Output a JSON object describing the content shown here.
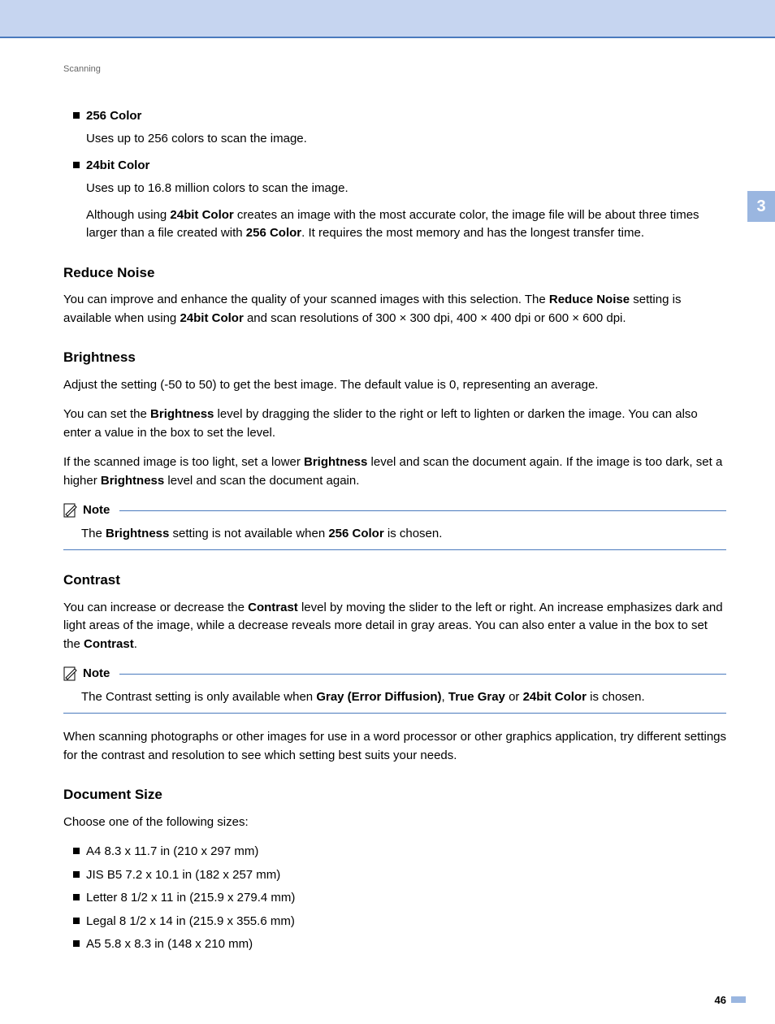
{
  "breadcrumb": "Scanning",
  "chapterTab": "3",
  "pageNumber": "46",
  "color256": {
    "title": "256 Color",
    "desc": "Uses up to 256 colors to scan the image."
  },
  "color24": {
    "title": "24bit Color",
    "desc1": "Uses up to 16.8 million colors to scan the image.",
    "desc2a": "Although using ",
    "desc2b": "24bit Color",
    "desc2c": " creates an image with the most accurate color, the image file will be about three times larger than a file created with ",
    "desc2d": "256 Color",
    "desc2e": ". It requires the most memory and has the longest transfer time."
  },
  "reduceNoise": {
    "heading": "Reduce Noise",
    "p1a": "You can improve and enhance the quality of your scanned images with this selection. The ",
    "p1b": "Reduce Noise",
    "p1c": " setting is available when using ",
    "p1d": "24bit Color",
    "p1e": " and scan resolutions of 300 × 300 dpi, 400 × 400 dpi or 600 × 600 dpi."
  },
  "brightness": {
    "heading": "Brightness",
    "p1": "Adjust the setting (-50 to 50) to get the best image. The default value is 0, representing an average.",
    "p2a": "You can set the ",
    "p2b": "Brightness",
    "p2c": " level by dragging the slider to the right or left to lighten or darken the image. You can also enter a value in the box to set the level.",
    "p3a": "If the scanned image is too light, set a lower ",
    "p3b": "Brightness",
    "p3c": " level and scan the document again. If the image is too dark, set a higher ",
    "p3d": "Brightness",
    "p3e": " level and scan the document again.",
    "noteLabel": "Note",
    "note1a": "The ",
    "note1b": "Brightness",
    "note1c": " setting is not available when ",
    "note1d": "256 Color",
    "note1e": " is chosen."
  },
  "contrast": {
    "heading": "Contrast",
    "p1a": "You can increase or decrease the ",
    "p1b": "Contrast",
    "p1c": " level by moving the slider to the left or right. An increase emphasizes dark and light areas of the image, while a decrease reveals more detail in gray areas. You can also enter a value in the box to set the ",
    "p1d": "Contrast",
    "p1e": ".",
    "noteLabel": "Note",
    "note1a": "The Contrast setting is only available when ",
    "note1b": "Gray (Error Diffusion)",
    "note1c": ", ",
    "note1d": "True Gray",
    "note1e": " or ",
    "note1f": "24bit Color",
    "note1g": " is chosen.",
    "after": "When scanning photographs or other images for use in a word processor or other graphics application, try different settings for the contrast and resolution to see which setting best suits your needs."
  },
  "docSize": {
    "heading": "Document Size",
    "intro": "Choose one of the following sizes:",
    "sizes": [
      "A4 8.3 x 11.7 in (210 x 297 mm)",
      "JIS B5 7.2 x 10.1 in (182 x 257 mm)",
      "Letter 8 1/2 x 11 in (215.9 x 279.4 mm)",
      "Legal 8 1/2 x 14 in (215.9 x 355.6 mm)",
      "A5 5.8 x 8.3 in (148 x 210 mm)"
    ]
  }
}
